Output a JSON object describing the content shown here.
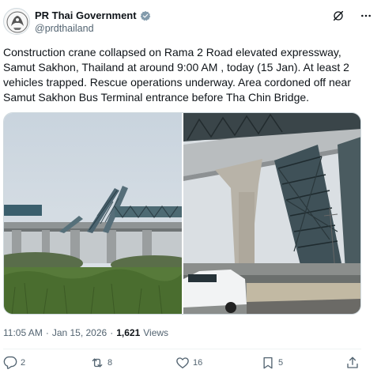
{
  "author": {
    "name": "PR Thai Government",
    "handle": "@prdthailand"
  },
  "post": {
    "text": "Construction crane collapsed on Rama 2 Road elevated expressway, Samut Sakhon, Thailand at around 9:00 AM , today (15 Jan). At least 2 vehicles trapped. Rescue operations underway. Area cordoned off near Samut Sakhon Bus Terminal entrance before Tha Chin Bridge.",
    "time": "11:05 AM",
    "separator": "·",
    "date": "Jan 15, 2026",
    "views_count": "1,621",
    "views_label": "Views"
  },
  "actions": {
    "replies": "2",
    "reposts": "8",
    "likes": "16",
    "bookmarks": "5"
  },
  "icons": {
    "verified": "verified-badge-icon",
    "grok": "grok-icon",
    "more": "more-icon",
    "reply": "reply-icon",
    "repost": "repost-icon",
    "like": "like-icon",
    "bookmark": "bookmark-icon",
    "share": "share-icon"
  },
  "colors": {
    "text": "#0f1419",
    "secondary": "#536471",
    "verified": "#829aab",
    "border": "#cfd9de"
  }
}
